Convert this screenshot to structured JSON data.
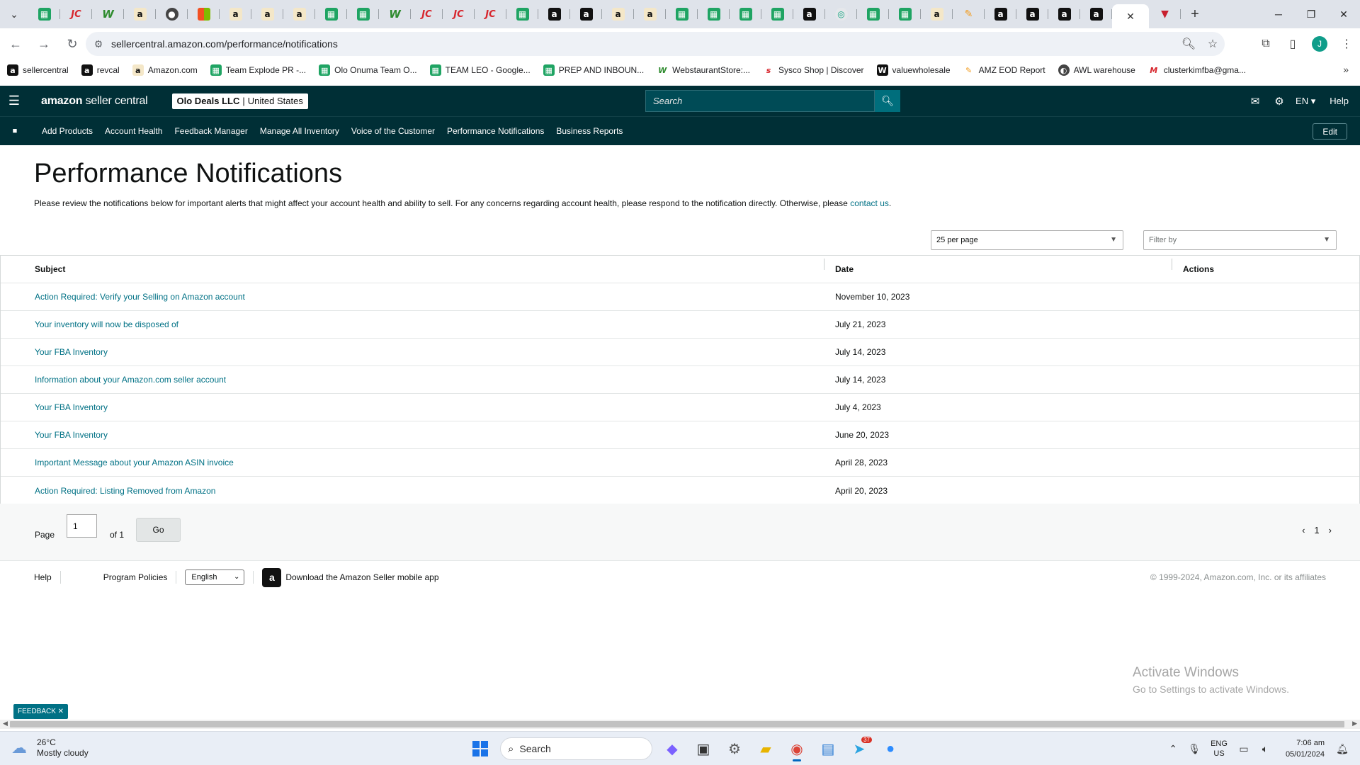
{
  "browser": {
    "tab_favicons": [
      "sheets",
      "jet",
      "webstaurant",
      "amazon",
      "misc",
      "microsoft",
      "amazon",
      "amazon",
      "amazon",
      "sheets",
      "sheets",
      "webstaurant",
      "jet",
      "jet",
      "jet",
      "sheets",
      "amazon-black",
      "amazon-black",
      "amazon",
      "amazon",
      "sheets",
      "sheets",
      "sheets",
      "sheets",
      "amazon-black",
      "chatgpt",
      "sheets",
      "sheets",
      "amazon",
      "pen",
      "amazon-black",
      "amazon-black",
      "amazon-black",
      "amazon-black"
    ],
    "active_tab_close": "✕",
    "extra_tab_favicon": "red-triangle",
    "new_tab": "+",
    "address": "sellercentral.amazon.com/performance/notifications",
    "profile_initial": "J",
    "bookmarks": [
      {
        "label": "sellercentral",
        "icon": "amazon-black"
      },
      {
        "label": "revcal",
        "icon": "amazon-black"
      },
      {
        "label": "Amazon.com",
        "icon": "amazon"
      },
      {
        "label": "Team Explode PR -...",
        "icon": "sheets"
      },
      {
        "label": "Olo Onuma Team O...",
        "icon": "sheets"
      },
      {
        "label": "TEAM LEO - Google...",
        "icon": "sheets"
      },
      {
        "label": "PREP AND INBOUN...",
        "icon": "sheets"
      },
      {
        "label": "WebstaurantStore:...",
        "icon": "webstaurant"
      },
      {
        "label": "Sysco Shop | Discover",
        "icon": "sysco"
      },
      {
        "label": "valuewholesale",
        "icon": "vw"
      },
      {
        "label": "AMZ EOD Report",
        "icon": "pen"
      },
      {
        "label": "AWL warehouse",
        "icon": "globe"
      },
      {
        "label": "clusterkimfba@gma...",
        "icon": "gmail"
      }
    ]
  },
  "header": {
    "logo_bold": "amazon",
    "logo_rest": " seller central",
    "account_name": "Olo Deals LLC",
    "account_separator": "|",
    "account_region": "United States",
    "search_placeholder": "Search",
    "language": "EN",
    "help": "Help"
  },
  "nav": {
    "links": [
      "Add Products",
      "Account Health",
      "Feedback Manager",
      "Manage All Inventory",
      "Voice of the Customer",
      "Performance Notifications",
      "Business Reports"
    ],
    "edit": "Edit"
  },
  "page": {
    "title": "Performance Notifications",
    "description": "Please review the notifications below for important alerts that might affect your account health and ability to sell. For any concerns regarding account health, please respond to the notification directly. Otherwise, please ",
    "contact_link": "contact us",
    "description_end": ".",
    "per_page": "25 per page",
    "filter_placeholder": "Filter by"
  },
  "table": {
    "headers": {
      "subject": "Subject",
      "date": "Date",
      "actions": "Actions"
    },
    "rows": [
      {
        "subject": "Action Required: Verify your Selling on Amazon account",
        "date": "November 10, 2023"
      },
      {
        "subject": "Your inventory will now be disposed of",
        "date": "July 21, 2023"
      },
      {
        "subject": "Your FBA Inventory",
        "date": "July 14, 2023"
      },
      {
        "subject": "Information about your Amazon.com seller account",
        "date": "July 14, 2023"
      },
      {
        "subject": "Your FBA Inventory",
        "date": "July 4, 2023"
      },
      {
        "subject": "Your FBA Inventory",
        "date": "June 20, 2023"
      },
      {
        "subject": "Important Message about your Amazon ASIN invoice",
        "date": "April 28, 2023"
      },
      {
        "subject": "Action Required: Listing Removed from Amazon",
        "date": "April 20, 2023"
      }
    ]
  },
  "pagination": {
    "page_label": "Page",
    "page_value": "1",
    "of_label": "of 1",
    "go": "Go",
    "current": "1"
  },
  "footer": {
    "help": "Help",
    "policies": "Program Policies",
    "language": "English",
    "app_text": "Download the Amazon Seller mobile app",
    "copyright": "© 1999-2024, Amazon.com, Inc. or its affiliates"
  },
  "watermark": {
    "line1": "Activate Windows",
    "line2": "Go to Settings to activate Windows."
  },
  "feedback": "FEEDBACK ✕",
  "taskbar": {
    "temperature": "26°C",
    "weather": "Mostly cloudy",
    "search": "Search",
    "telegram_badge": "37",
    "lang_top": "ENG",
    "lang_bottom": "US",
    "time": "7:06 am",
    "date": "05/01/2024"
  }
}
